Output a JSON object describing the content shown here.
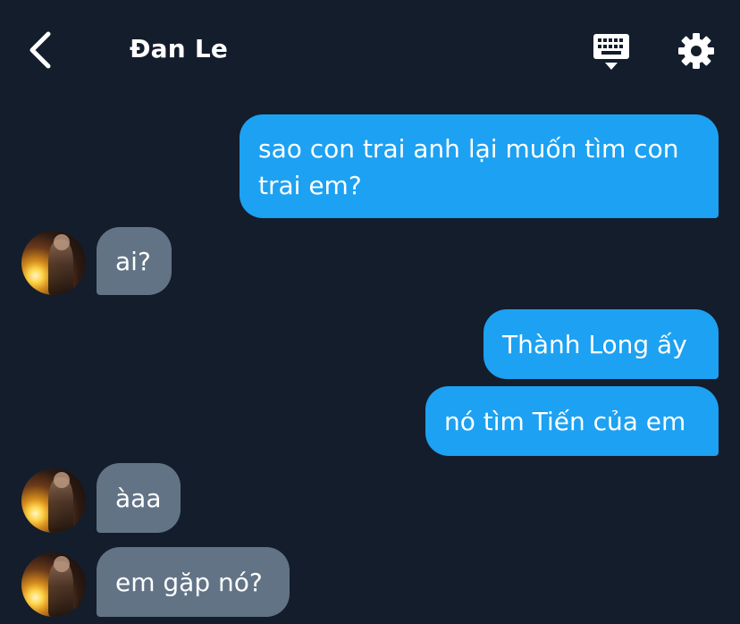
{
  "header": {
    "title": "Đan Le",
    "back_icon": "chevron-left-icon",
    "keyboard_icon": "keyboard-icon",
    "settings_icon": "gear-icon"
  },
  "colors": {
    "background": "#141d2b",
    "outgoing_bubble": "#1da1f2",
    "incoming_bubble": "#627386",
    "text": "#ffffff"
  },
  "messages": [
    {
      "direction": "outgoing",
      "text": "sao con trai anh lại muốn tìm con trai em?"
    },
    {
      "direction": "incoming",
      "text": "ai?"
    },
    {
      "direction": "outgoing",
      "text": "Thành Long ấy"
    },
    {
      "direction": "outgoing",
      "text": "nó tìm Tiến của em"
    },
    {
      "direction": "incoming",
      "text": "àaa"
    },
    {
      "direction": "incoming",
      "text": "em gặp nó?"
    }
  ]
}
